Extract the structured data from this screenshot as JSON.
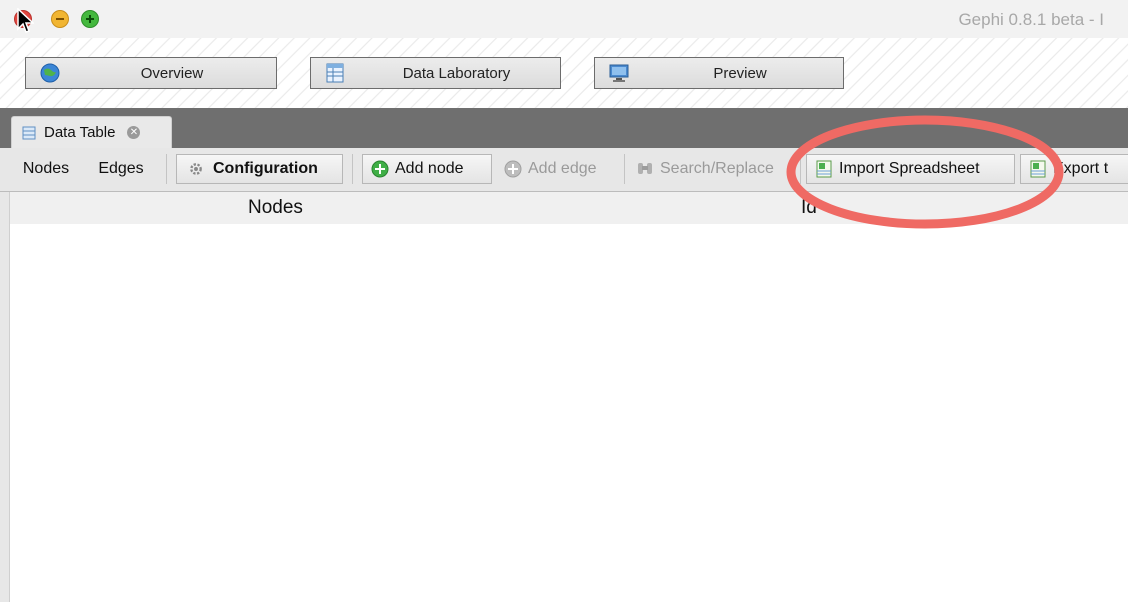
{
  "window": {
    "title": "Gephi 0.8.1 beta - I"
  },
  "workspaces": [
    {
      "label": "Overview",
      "icon": "globe-icon"
    },
    {
      "label": "Data Laboratory",
      "icon": "spreadsheet-icon"
    },
    {
      "label": "Preview",
      "icon": "monitor-icon"
    }
  ],
  "tabs": [
    {
      "label": "Data Table",
      "icon": "table-icon"
    }
  ],
  "toolbar": {
    "nodes_label": "Nodes",
    "edges_label": "Edges",
    "configuration_label": "Configuration",
    "add_node_label": "Add node",
    "add_edge_label": "Add edge",
    "search_replace_label": "Search/Replace",
    "import_spreadsheet_label": "Import Spreadsheet",
    "export_label": "Export t"
  },
  "table": {
    "columns": [
      "Nodes",
      "Id"
    ]
  },
  "colors": {
    "annotation_circle": "#ef6a64"
  }
}
